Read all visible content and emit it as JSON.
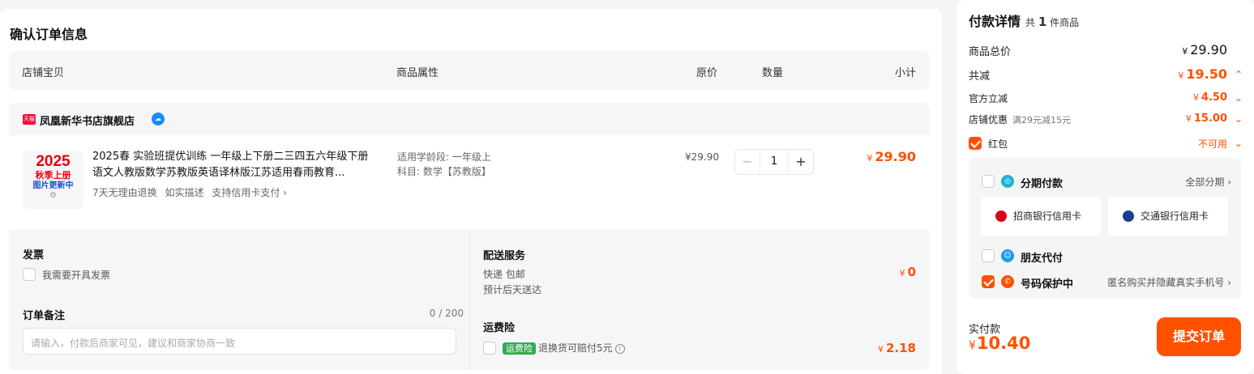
{
  "order": {
    "title": "确认订单信息",
    "columns": [
      "店铺宝贝",
      "商品属性",
      "原价",
      "数量",
      "小计"
    ],
    "shop": {
      "badge": "天猫",
      "name": "凤凰新华书店旗舰店",
      "item": {
        "thumb": {
          "year": "2025",
          "line1": "秋季上册",
          "line2": "图片更新中",
          "spinner": "⚙"
        },
        "title": "2025春 实验班提优训练 一年级上下册二三四五六年级下册语文人教版数学苏教版英语译林版江苏适用春雨教育...",
        "tags": [
          "7天无理由退换",
          "如实描述",
          "支持信用卡支付 ›"
        ],
        "attr_grade": "适用学龄段: 一年级上",
        "attr_subject": "科目: 数学【苏教版】",
        "original_price": "¥29.90",
        "qty_minus": "−",
        "quantity": "1",
        "qty_plus": "+",
        "subtotal_symbol": "¥",
        "subtotal": "29.90"
      }
    },
    "invoice": {
      "title": "发票",
      "option": "我需要开具发票"
    },
    "remark": {
      "title": "订单备注",
      "counter": "0 / 200",
      "placeholder": "请输入，付款后商家可见，建议和商家协商一致"
    },
    "delivery": {
      "title": "配送服务",
      "method": "快递 包邮",
      "eta": "预计后天送达",
      "price_symbol": "¥",
      "price": "0"
    },
    "insurance": {
      "title": "运费险",
      "badge": "运费险",
      "text": "退换货可赔付5元",
      "info": "i",
      "price_symbol": "¥",
      "price": "2.18"
    }
  },
  "payment": {
    "title": "付款详情",
    "count_prefix": "共",
    "count": "1",
    "count_suffix": "件商品",
    "rows": {
      "goods_total_label": "商品总价",
      "goods_total_symbol": "¥",
      "goods_total": "29.90",
      "discount_label": "共减",
      "discount_symbol": "¥",
      "discount": "19.50",
      "official_label": "官方立减",
      "official_symbol": "¥",
      "official": "4.50",
      "shop_label": "店铺优惠",
      "shop_sub": "满29元减15元",
      "shop_symbol": "¥",
      "shop": "15.00",
      "redpacket_label": "红包",
      "redpacket_value": "不可用"
    },
    "installment": {
      "label": "分期付款",
      "note": "全部分期 ›",
      "banks": [
        "招商银行信用卡",
        "交通银行信用卡"
      ]
    },
    "friend_pay": {
      "label": "朋友代付"
    },
    "privacy": {
      "label": "号码保护中",
      "note": "匿名购买并隐藏真实手机号 ›"
    },
    "total_label": "实付款",
    "total_symbol": "¥",
    "total": "10.40",
    "submit": "提交订单"
  },
  "colors": {
    "accent": "#ff5000",
    "tmall": "#ff0036",
    "insurance": "#34a853"
  },
  "icons": {
    "shop_badge": "tmall-logo-icon",
    "chat": "wangwang-chat-icon",
    "installment": "installment-icon",
    "friend": "friend-pay-icon",
    "privacy": "phone-shield-icon"
  }
}
